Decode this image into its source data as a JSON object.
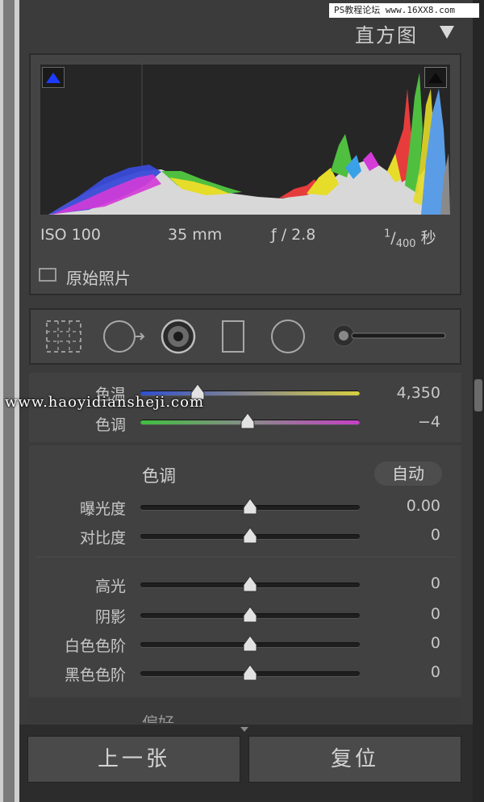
{
  "watermark_top": "PS教程论坛 www.16XX8.com",
  "watermark_mid": "www.haoyidiansheji.com",
  "histogram": {
    "title": "直方图",
    "iso": "ISO 100",
    "focal": "35 mm",
    "aperture": "ƒ / 2.8",
    "shutter_num": "1",
    "shutter_den": "400",
    "shutter_unit": "秒",
    "original_photo_label": "原始照片"
  },
  "white_balance": {
    "temp": {
      "label": "色温",
      "value": "4,350",
      "position": 0.26
    },
    "tint": {
      "label": "色调",
      "value": "−4",
      "position": 0.49
    }
  },
  "tone": {
    "title": "色调",
    "auto_label": "自动",
    "sliders": [
      {
        "label": "曝光度",
        "value": "0.00",
        "position": 0.5
      },
      {
        "label": "对比度",
        "value": "0",
        "position": 0.5
      },
      {
        "label": "高光",
        "value": "0",
        "position": 0.5
      },
      {
        "label": "阴影",
        "value": "0",
        "position": 0.5
      },
      {
        "label": "白色色阶",
        "value": "0",
        "position": 0.5
      },
      {
        "label": "黑色色阶",
        "value": "0",
        "position": 0.5
      }
    ]
  },
  "presence_title": "偏好",
  "buttons": {
    "previous": "上一张",
    "reset": "复位"
  },
  "colors": {
    "panel": "#3b3b3b",
    "section": "#414141",
    "accent_blue": "#1c3cff"
  }
}
